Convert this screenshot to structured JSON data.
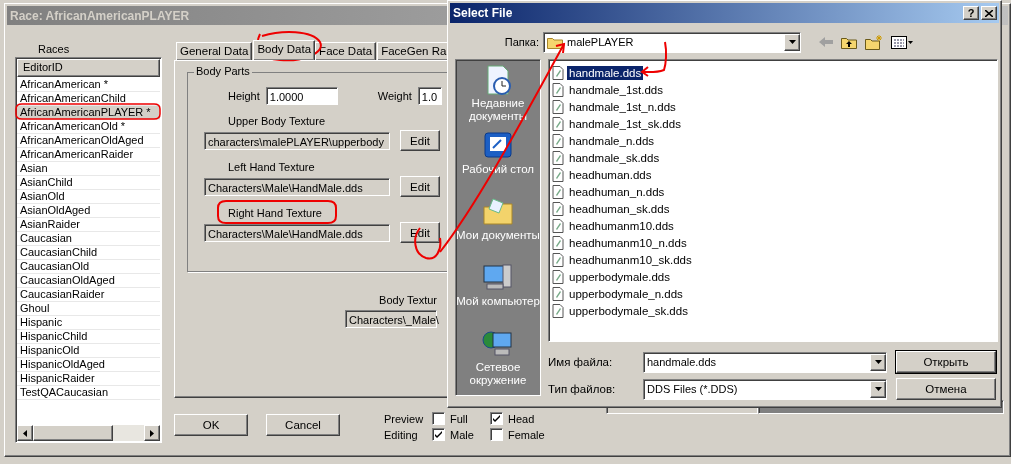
{
  "main_window": {
    "title": "Race: AfricanAmericanPLAYER",
    "races_list": {
      "label": "Races",
      "column": "EditorID",
      "items": [
        {
          "name": "AfricanAmerican *",
          "selected": false
        },
        {
          "name": "AfricanAmericanChild",
          "selected": false
        },
        {
          "name": "AfricanAmericanPLAYER *",
          "selected": true
        },
        {
          "name": "AfricanAmericanOld *",
          "selected": false
        },
        {
          "name": "AfricanAmericanOldAged",
          "selected": false
        },
        {
          "name": "AfricanAmericanRaider",
          "selected": false
        },
        {
          "name": "Asian",
          "selected": false
        },
        {
          "name": "AsianChild",
          "selected": false
        },
        {
          "name": "AsianOld",
          "selected": false
        },
        {
          "name": "AsianOldAged",
          "selected": false
        },
        {
          "name": "AsianRaider",
          "selected": false
        },
        {
          "name": "Caucasian",
          "selected": false
        },
        {
          "name": "CaucasianChild",
          "selected": false
        },
        {
          "name": "CaucasianOld",
          "selected": false
        },
        {
          "name": "CaucasianOldAged",
          "selected": false
        },
        {
          "name": "CaucasianRaider",
          "selected": false
        },
        {
          "name": "Ghoul",
          "selected": false
        },
        {
          "name": "Hispanic",
          "selected": false
        },
        {
          "name": "HispanicChild",
          "selected": false
        },
        {
          "name": "HispanicOld",
          "selected": false
        },
        {
          "name": "HispanicOldAged",
          "selected": false
        },
        {
          "name": "HispanicRaider",
          "selected": false
        },
        {
          "name": "TestQACaucasian",
          "selected": false
        }
      ]
    },
    "tabs": [
      {
        "label": "General Data",
        "selected": false
      },
      {
        "label": "Body Data",
        "selected": true
      },
      {
        "label": "Face Data",
        "selected": false
      },
      {
        "label": "FaceGen Ra",
        "selected": false
      }
    ],
    "body_parts": {
      "title": "Body Parts",
      "height": {
        "label": "Height",
        "value": "1.0000"
      },
      "weight": {
        "label": "Weight",
        "value": "1.0"
      },
      "textures": [
        {
          "label": "Upper Body Texture",
          "value": "characters\\malePLAYER\\upperbody",
          "button": "Edit"
        },
        {
          "label": "Left Hand Texture",
          "value": "Characters\\Male\\HandMale.dds",
          "button": "Edit"
        },
        {
          "label": "Right Hand Texture",
          "value": "Characters\\Male\\HandMale.dds",
          "button": "Edit"
        }
      ]
    },
    "body_texture": {
      "label": "Body Textur",
      "value": "Characters\\_Male\\"
    },
    "buttons": [
      "OK",
      "Cancel"
    ],
    "preview": {
      "label": "Preview",
      "options": [
        {
          "label": "Full",
          "checked": false
        },
        {
          "label": "Head",
          "checked": true
        }
      ]
    },
    "editing": {
      "label": "Editing",
      "options": [
        {
          "label": "Male",
          "checked": true
        },
        {
          "label": "Female",
          "checked": false
        }
      ]
    }
  },
  "dialog": {
    "title": "Select File",
    "help": "?",
    "folder": {
      "label": "Папка:",
      "value": "malePLAYER"
    },
    "places": [
      {
        "label": "Недавние документы",
        "kind": "recent"
      },
      {
        "label": "Рабочий стол",
        "kind": "desktop"
      },
      {
        "label": "Мои документы",
        "kind": "documents"
      },
      {
        "label": "Мой компьютер",
        "kind": "computer"
      },
      {
        "label": "Сетевое окружение",
        "kind": "network"
      }
    ],
    "files": [
      {
        "name": "handmale.dds",
        "selected": true
      },
      {
        "name": "handmale_1st.dds",
        "selected": false
      },
      {
        "name": "handmale_1st_n.dds",
        "selected": false
      },
      {
        "name": "handmale_1st_sk.dds",
        "selected": false
      },
      {
        "name": "handmale_n.dds",
        "selected": false
      },
      {
        "name": "handmale_sk.dds",
        "selected": false
      },
      {
        "name": "headhuman.dds",
        "selected": false
      },
      {
        "name": "headhuman_n.dds",
        "selected": false
      },
      {
        "name": "headhuman_sk.dds",
        "selected": false
      },
      {
        "name": "headhumanm10.dds",
        "selected": false
      },
      {
        "name": "headhumanm10_n.dds",
        "selected": false
      },
      {
        "name": "headhumanm10_sk.dds",
        "selected": false
      },
      {
        "name": "upperbodymale.dds",
        "selected": false
      },
      {
        "name": "upperbodymale_n.dds",
        "selected": false
      },
      {
        "name": "upperbodymale_sk.dds",
        "selected": false
      }
    ],
    "file_name": {
      "label": "Имя файла:",
      "value": "handmale.dds"
    },
    "file_type": {
      "label": "Тип файлов:",
      "value": "DDS Files (*.DDS)"
    },
    "buttons": [
      {
        "label": "Открыть",
        "default": true
      },
      {
        "label": "Отмена",
        "default": false
      }
    ]
  }
}
